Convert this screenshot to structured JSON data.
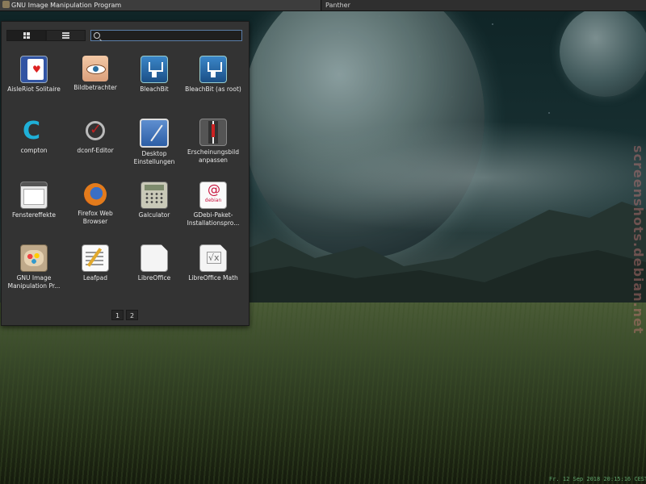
{
  "taskbar": {
    "tasks": [
      {
        "label": "GNU Image Manipulation Program",
        "active": true
      },
      {
        "label": "Panther",
        "active": false
      }
    ]
  },
  "launcher": {
    "view_modes": [
      {
        "icon": "grid-view-icon",
        "active": true
      },
      {
        "icon": "list-view-icon",
        "active": false
      }
    ],
    "search": {
      "value": "",
      "placeholder": ""
    },
    "apps": [
      {
        "label": "AisleRiot Solitaire",
        "icon": "solitaire-icon"
      },
      {
        "label": "Bildbetrachter",
        "icon": "image-viewer-icon"
      },
      {
        "label": "BleachBit",
        "icon": "bleachbit-icon"
      },
      {
        "label": "BleachBit (as root)",
        "icon": "bleachbit-root-icon"
      },
      {
        "label": "compton",
        "icon": "compton-icon"
      },
      {
        "label": "dconf-Editor",
        "icon": "dconf-icon"
      },
      {
        "label": "Desktop Einstellungen",
        "icon": "desktop-settings-icon"
      },
      {
        "label": "Erscheinungsbild anpassen",
        "icon": "appearance-icon"
      },
      {
        "label": "Fenstereffekte",
        "icon": "window-effects-icon"
      },
      {
        "label": "Firefox Web Browser",
        "icon": "firefox-icon"
      },
      {
        "label": "Galculator",
        "icon": "calculator-icon"
      },
      {
        "label": "GDebi-Paket-Installationspro...",
        "icon": "gdebi-icon"
      },
      {
        "label": "GNU Image Manipulation Pr...",
        "icon": "gimp-icon"
      },
      {
        "label": "Leafpad",
        "icon": "leafpad-icon"
      },
      {
        "label": "LibreOffice",
        "icon": "libreoffice-icon"
      },
      {
        "label": "LibreOffice Math",
        "icon": "libreoffice-math-icon"
      }
    ],
    "pages": [
      "1",
      "2"
    ],
    "current_page": "1"
  },
  "desktop": {
    "watermark": "screenshots.debian.net",
    "clock": "Fr. 12 Sep 2018 20:15:16 CEST"
  }
}
